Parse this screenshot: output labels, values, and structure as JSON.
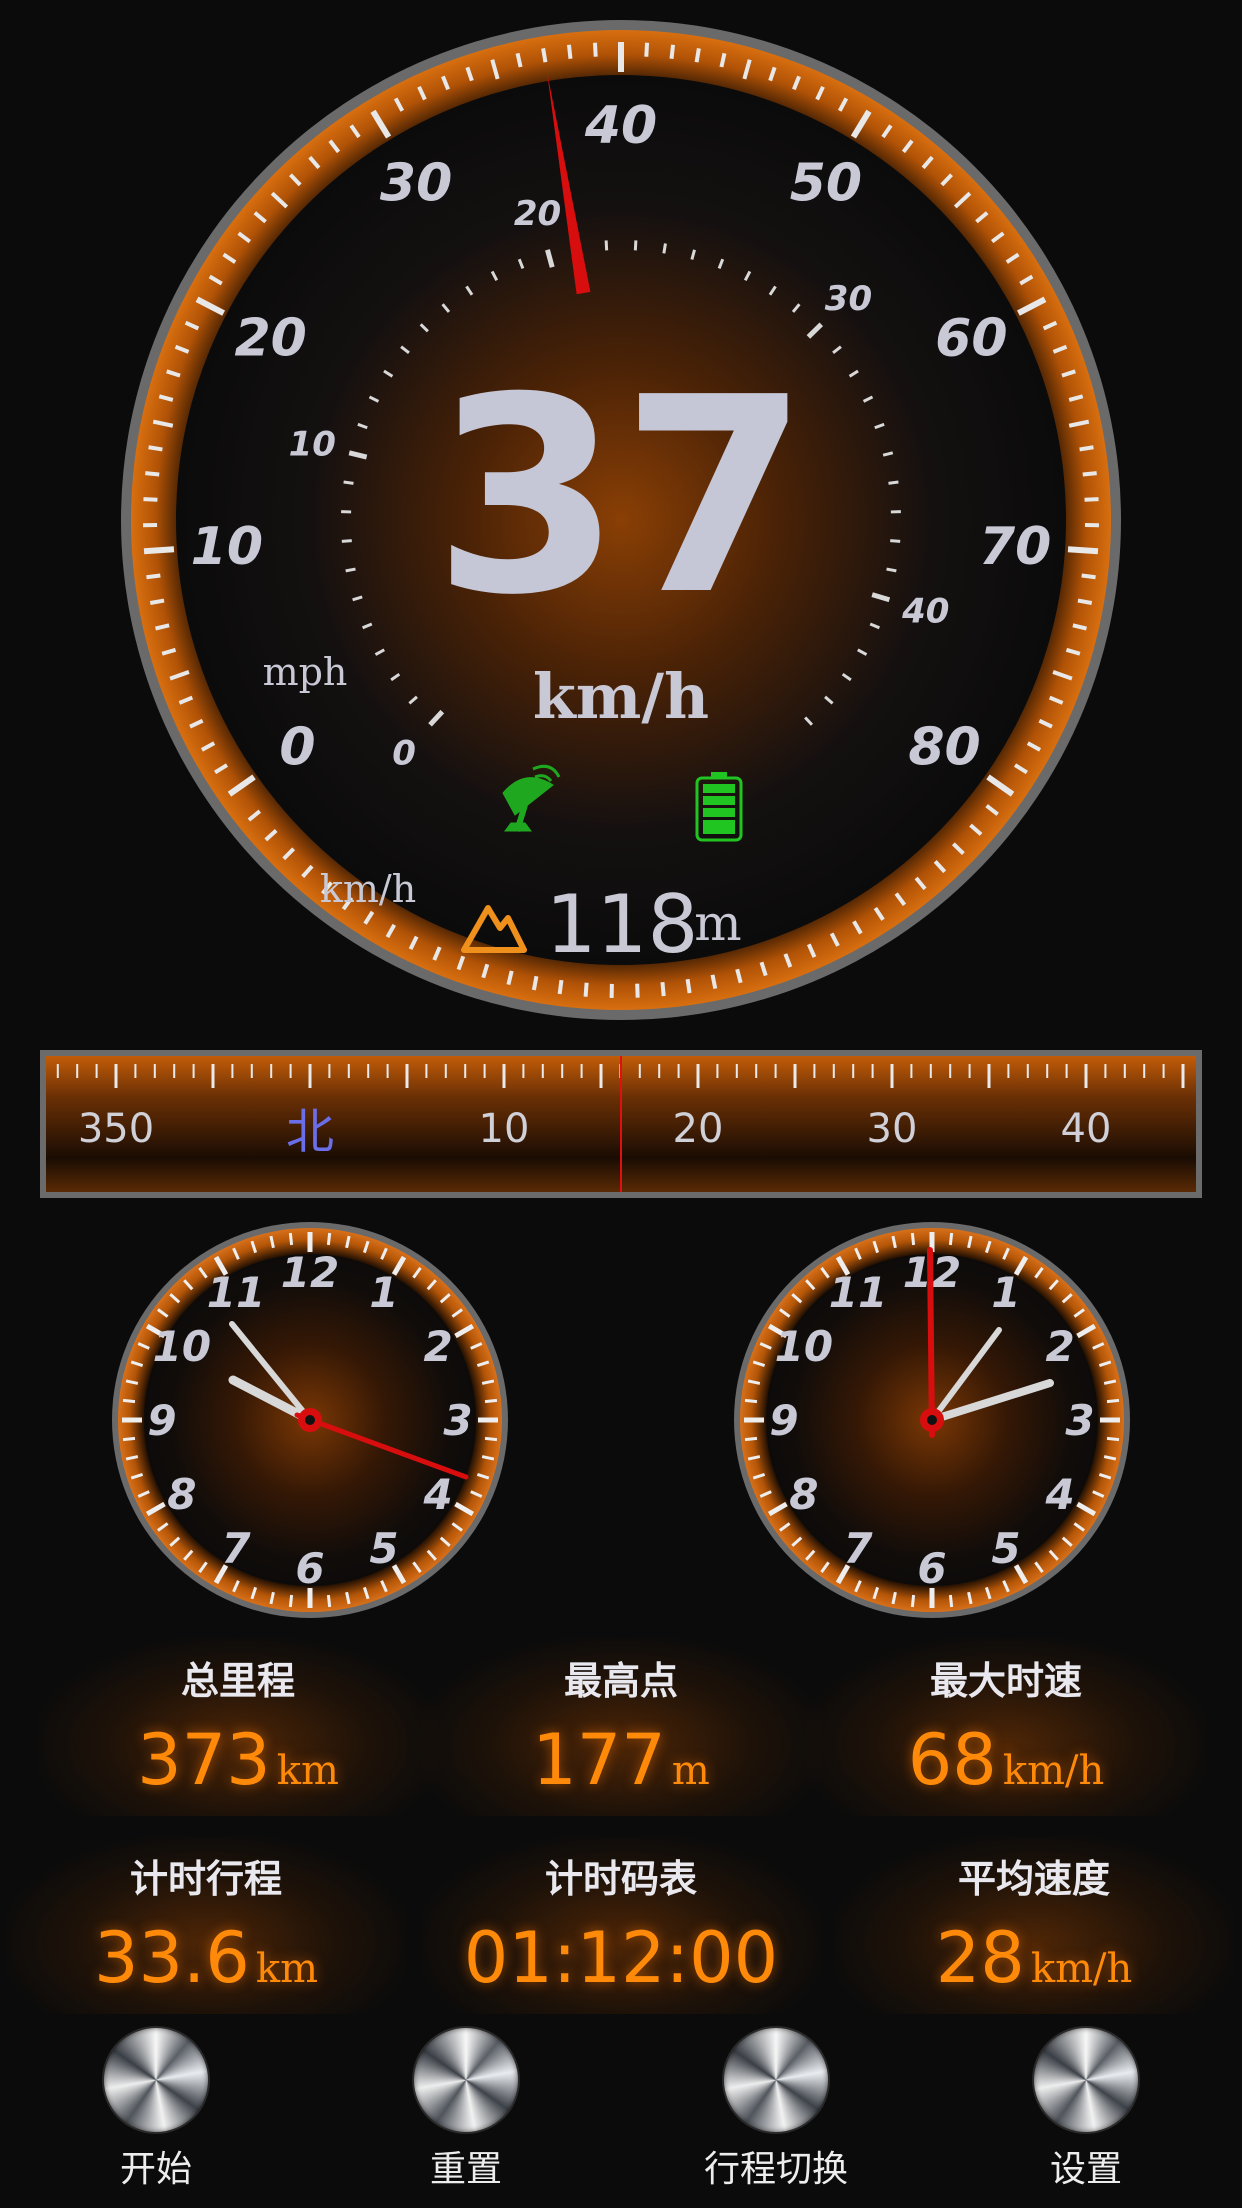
{
  "speedometer": {
    "speed": "37",
    "unit": "km/h",
    "kmh_ticks": [
      "0",
      "10",
      "20",
      "30",
      "40",
      "50",
      "60",
      "70",
      "80"
    ],
    "mph_ticks": [
      "0",
      "10",
      "20",
      "30",
      "40"
    ],
    "mph_label": "mph",
    "kmh_label": "km/h",
    "needle_value_kmh": 37
  },
  "status_icons": {
    "gps": "satellite-dish-icon",
    "battery": "battery-icon",
    "gps_color": "#1fa81f",
    "battery_color": "#21c521"
  },
  "altitude": {
    "value": "118",
    "unit": "m",
    "icon": "mountain-icon"
  },
  "compass": {
    "labels": [
      "350",
      "北",
      "10",
      "20",
      "30",
      "40"
    ],
    "heading_marker_color": "#e01010"
  },
  "clocks": {
    "left": {
      "numbers": [
        "12",
        "1",
        "2",
        "3",
        "4",
        "5",
        "6",
        "7",
        "8",
        "9",
        "10",
        "11"
      ]
    },
    "right": {
      "numbers": [
        "12",
        "1",
        "2",
        "3",
        "4",
        "5",
        "6",
        "7",
        "8",
        "9",
        "10",
        "11"
      ]
    }
  },
  "stats": [
    {
      "label": "总里程",
      "value": "373",
      "unit": "km"
    },
    {
      "label": "最高点",
      "value": "177",
      "unit": "m"
    },
    {
      "label": "最大时速",
      "value": "68",
      "unit": "km/h"
    },
    {
      "label": "计时行程",
      "value": "33.6",
      "unit": "km"
    },
    {
      "label": "计时码表",
      "value": "01:12:00",
      "unit": ""
    },
    {
      "label": "平均速度",
      "value": "28",
      "unit": "km/h"
    }
  ],
  "buttons": [
    {
      "label": "开始"
    },
    {
      "label": "重置"
    },
    {
      "label": "行程切换"
    },
    {
      "label": "设置"
    }
  ],
  "colors": {
    "accent": "#ff8a0a",
    "needle": "#e01010",
    "dial_text": "#c9c9d6"
  }
}
